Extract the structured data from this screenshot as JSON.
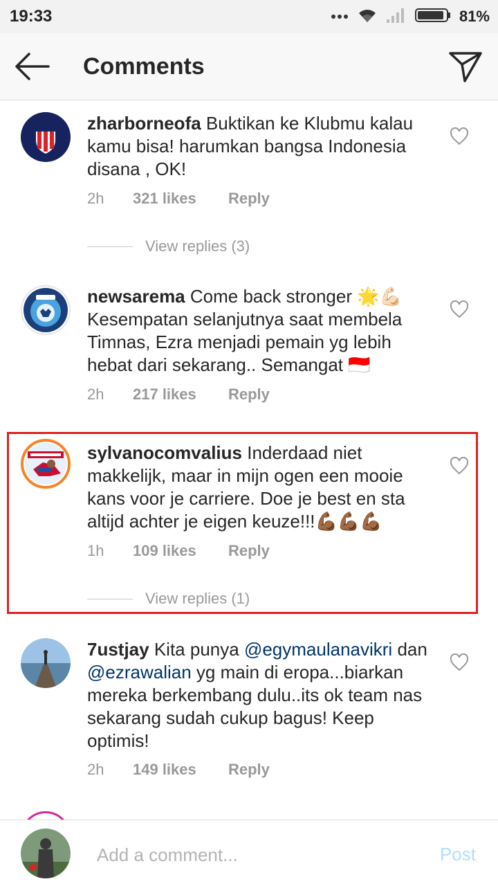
{
  "status_bar": {
    "time": "19:33",
    "battery": "81%"
  },
  "header": {
    "title": "Comments"
  },
  "comments": [
    {
      "username": "zharborneofa",
      "text": "Buktikan ke Klubmu kalau kamu bisa! harumkan bangsa Indonesia disana , OK!",
      "time": "2h",
      "likes": "321 likes",
      "reply": "Reply",
      "view_replies": "View replies (3)"
    },
    {
      "username": "newsarema",
      "text": "Come back stronger 🌟💪🏻 Kesempatan selanjutnya saat membela Timnas, Ezra menjadi pemain yg lebih hebat dari sekarang.. Semangat 🇮🇩",
      "time": "2h",
      "likes": "217 likes",
      "reply": "Reply"
    },
    {
      "username": "sylvanocomvalius",
      "text": "Inderdaad niet makkelijk, maar in mijn ogen een mooie kans voor je carriere. Doe je best en sta altijd achter je eigen keuze!!!💪🏾💪🏾💪🏾",
      "time": "1h",
      "likes": "109 likes",
      "reply": "Reply",
      "view_replies": "View replies (1)"
    },
    {
      "username": "7ustjay",
      "text_part1": "Kita punya",
      "mention1": "@egymaulanavikri",
      "text_part2": "dan",
      "mention2": "@ezrawalian",
      "text_part3": " yg main di eropa...biarkan mereka berkembang dulu..its ok team nas sekarang sudah cukup bagus! Keep optimis!",
      "time": "2h",
      "likes": "149 likes",
      "reply": "Reply"
    }
  ],
  "bottom_bar": {
    "placeholder": "Add a comment...",
    "post_label": "Post"
  },
  "colors": {
    "highlight": "#e02020",
    "mention": "#003569",
    "post": "#b2dffc"
  }
}
